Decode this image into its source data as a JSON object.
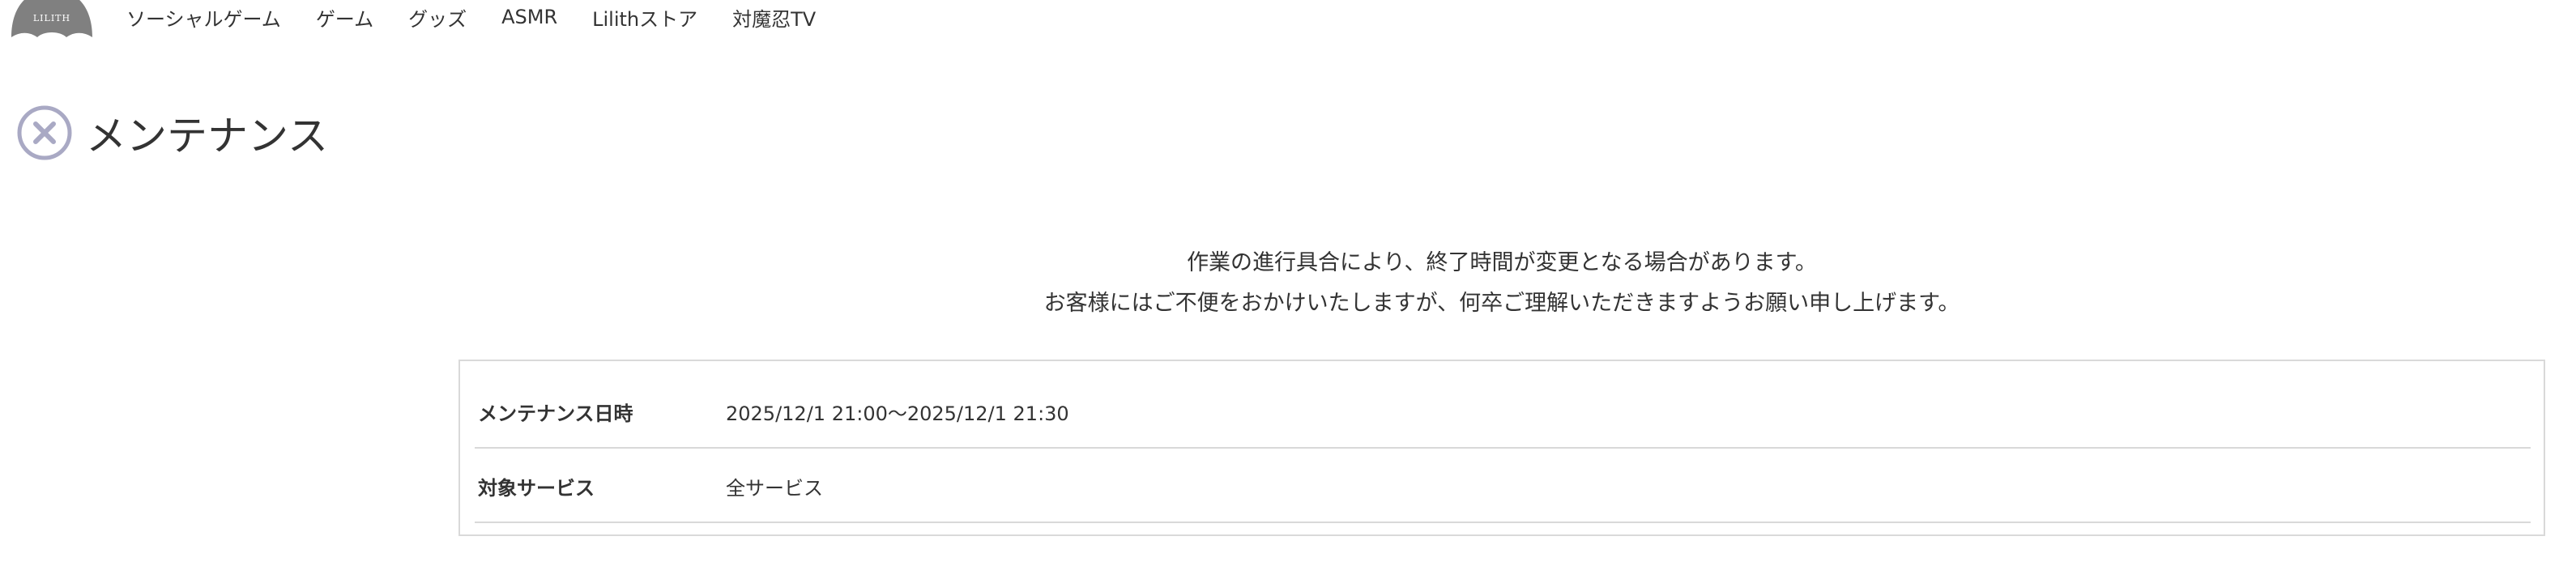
{
  "header": {
    "logo_text": "LILITH",
    "nav_items": [
      {
        "label": "ソーシャルゲーム"
      },
      {
        "label": "ゲーム"
      },
      {
        "label": "グッズ"
      },
      {
        "label": "ASMR"
      },
      {
        "label": "Lilithストア"
      },
      {
        "label": "対魔忍TV"
      }
    ]
  },
  "main": {
    "title": "メンテナンス",
    "title_icon": "close-circle-icon",
    "message_lines": [
      "作業の進行具合により、終了時間が変更となる場合があります。",
      "お客様にはご不便をおかけいたしますが、何卒ご理解いただきますようお願い申し上げます。"
    ],
    "info_rows": [
      {
        "label": "メンテナンス日時",
        "value": "2025/12/1 21:00〜2025/12/1 21:30"
      },
      {
        "label": "対象サービス",
        "value": "全サービス"
      }
    ]
  },
  "colors": {
    "text": "#333333",
    "icon": "#a9a9c4",
    "logo": "#808080",
    "border": "#d9d9d9",
    "background": "#ffffff"
  }
}
